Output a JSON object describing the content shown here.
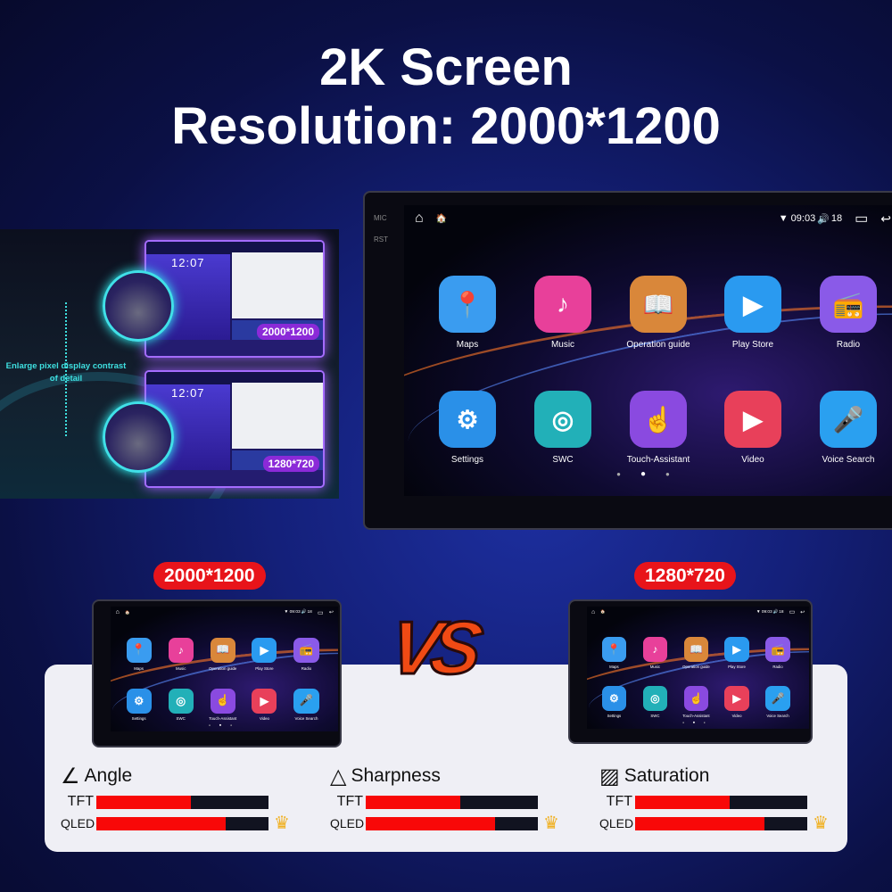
{
  "title": {
    "line1": "2K Screen",
    "line2": "Resolution: 2000*1200"
  },
  "inset": {
    "caption": "Enlarge pixel display contrast of detail",
    "clock": "12:07",
    "tags": [
      "2000*1200",
      "1280*720"
    ]
  },
  "device": {
    "side_labels": [
      "MIC",
      "RST"
    ],
    "status": {
      "time": "09:03",
      "volume": "18"
    },
    "apps": [
      {
        "label": "Maps",
        "icon": "maps-icon",
        "color": "#3a9cf0",
        "glyph": "📍"
      },
      {
        "label": "Music",
        "icon": "music-icon",
        "color": "#e8409a",
        "glyph": "♪"
      },
      {
        "label": "Operation guide",
        "icon": "book-icon",
        "color": "#d9873a",
        "glyph": "📖"
      },
      {
        "label": "Play Store",
        "icon": "play-store-icon",
        "color": "#2a9af0",
        "glyph": "▶"
      },
      {
        "label": "Radio",
        "icon": "radio-icon",
        "color": "#8a5ae8",
        "glyph": "📻"
      },
      {
        "label": "Settings",
        "icon": "gear-icon",
        "color": "#2a90e8",
        "glyph": "⚙"
      },
      {
        "label": "SWC",
        "icon": "steering-wheel-icon",
        "color": "#22b0b8",
        "glyph": "◎"
      },
      {
        "label": "Touch-Assistant",
        "icon": "touch-icon",
        "color": "#8a4ae0",
        "glyph": "☝"
      },
      {
        "label": "Video",
        "icon": "video-icon",
        "color": "#e8405a",
        "glyph": "▶"
      },
      {
        "label": "Voice Search",
        "icon": "microphone-icon",
        "color": "#2aa0f0",
        "glyph": "🎤"
      }
    ],
    "page": 2,
    "pages": 3
  },
  "compare": {
    "left": "2000*1200",
    "right": "1280*720",
    "vs": "VS"
  },
  "metrics": [
    {
      "name": "Angle",
      "icon": "angle-icon",
      "rows": [
        {
          "label": "TFT",
          "value": 55
        },
        {
          "label": "QLED",
          "value": 75
        }
      ],
      "winner": "QLED"
    },
    {
      "name": "Sharpness",
      "icon": "triangle-icon",
      "rows": [
        {
          "label": "TFT",
          "value": 55
        },
        {
          "label": "QLED",
          "value": 75
        }
      ],
      "winner": "QLED"
    },
    {
      "name": "Saturation",
      "icon": "hatched-square-icon",
      "rows": [
        {
          "label": "TFT",
          "value": 55
        },
        {
          "label": "QLED",
          "value": 75
        }
      ],
      "winner": "QLED"
    }
  ],
  "colors": {
    "accent_red": "#e8141a",
    "bar_fill": "#f80808",
    "bar_track": "#111320",
    "inset_glow": "#3ee0e0",
    "tag_purple": "#8b2ad8"
  }
}
